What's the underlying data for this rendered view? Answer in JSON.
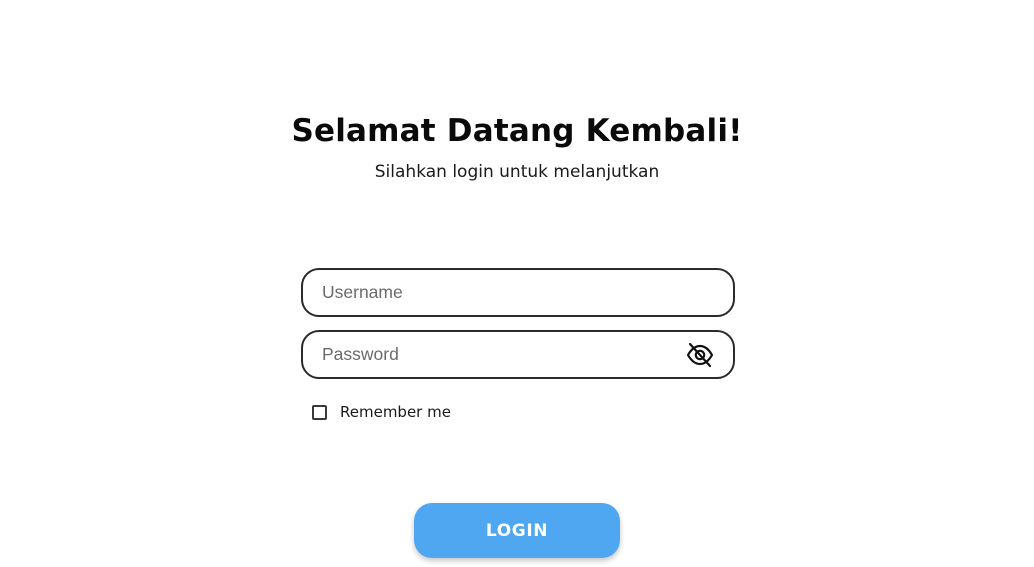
{
  "header": {
    "title": "Selamat Datang Kembali!",
    "subtitle": "Silahkan login untuk melanjutkan"
  },
  "form": {
    "username": {
      "placeholder": "Username",
      "value": ""
    },
    "password": {
      "placeholder": "Password",
      "value": "",
      "toggle_icon": "eye-slash-icon"
    },
    "remember_me": {
      "label": "Remember me",
      "checked": false
    },
    "login_label": "LOGIN"
  },
  "colors": {
    "accent": "#4ea7f0",
    "border": "#2b2b2b",
    "text": "#0a0a0a"
  }
}
